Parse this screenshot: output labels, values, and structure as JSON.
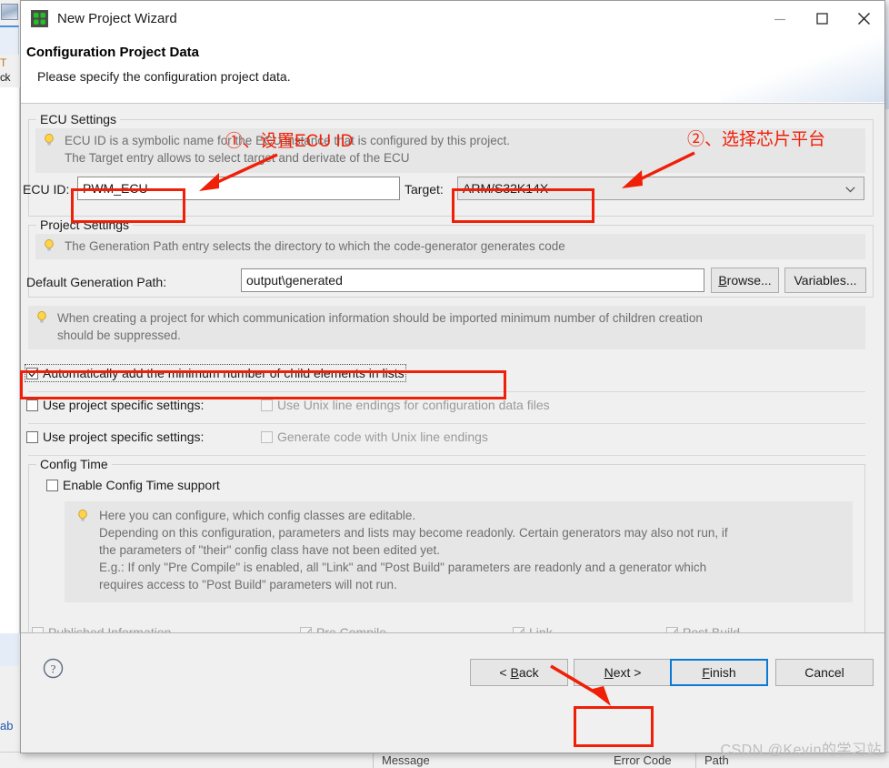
{
  "window": {
    "title": "New Project Wizard",
    "icon": "puzzle-squares-icon",
    "minimize_label": "Minimize",
    "maximize_label": "Maximize",
    "close_label": "Close"
  },
  "wizard": {
    "heading": "Configuration Project Data",
    "subheading": "Please specify the configuration project data."
  },
  "ecu_settings": {
    "group_label": "ECU Settings",
    "hint_line1": "ECU ID is a symbolic name for the ECU instance that is configured by this project.",
    "hint_line2": "The Target entry allows to select target and derivate of the ECU",
    "ecu_id_label": "ECU ID:",
    "ecu_id_value": "PWM_ECU",
    "target_label": "Target:",
    "target_value": "ARM/S32K14X"
  },
  "project_settings": {
    "group_label": "Project Settings",
    "hint": "The Generation Path entry selects the directory to which the code-generator generates code",
    "path_label": "Default Generation Path:",
    "path_value": "output\\generated",
    "browse_label": "Browse...",
    "variables_label": "Variables..."
  },
  "minimum_children": {
    "hint_line1": "When creating a project for which communication information should be imported minimum number of children creation",
    "hint_line2": "should be suppressed.",
    "auto_add_label": "Automatically add the minimum number of child elements in lists",
    "auto_add_checked": true
  },
  "line_endings": {
    "row1_project_specific_label": "Use project specific settings:",
    "row1_project_specific_checked": false,
    "row1_option_label": "Use Unix line endings for configuration data files",
    "row1_option_checked": false,
    "row2_project_specific_label": "Use project specific settings:",
    "row2_project_specific_checked": false,
    "row2_option_label": "Generate code with Unix line endings",
    "row2_option_checked": false
  },
  "config_time": {
    "group_label": "Config Time",
    "enable_label": "Enable Config Time support",
    "enable_checked": false,
    "hint_line1": "Here you can configure, which config classes are editable.",
    "hint_line2": "Depending on this configuration, parameters and lists may become readonly. Certain generators may also not run, if",
    "hint_line3": "the parameters of \"their\" config class have not been edited yet.",
    "hint_line4": "E.g.: If only \"Pre Compile\" is enabled, all \"Link\" and \"Post Build\" parameters are readonly and a generator which",
    "hint_line5": "requires access to \"Post Build\" parameters will not run.",
    "classes": [
      {
        "label": "Published Information",
        "mnemonic": "h",
        "checked": false,
        "enabled": false
      },
      {
        "label": "Pre Compile",
        "mnemonic": "P",
        "checked": true,
        "enabled": false
      },
      {
        "label": "Link",
        "mnemonic": "k",
        "checked": true,
        "enabled": false
      },
      {
        "label": "Post Build",
        "mnemonic": "B",
        "checked": true,
        "enabled": false
      }
    ]
  },
  "buttons": {
    "help": "?",
    "back": "< Back",
    "next": "Next >",
    "finish": "Finish",
    "cancel": "Cancel"
  },
  "annotations": {
    "step1": "①、设置ECU ID",
    "step2": "②、选择芯片平台"
  },
  "background": {
    "problems_message_col": "Message",
    "problems_errorcode_col": "Error Code",
    "problems_path_col": "Path",
    "tab_label_1": "T",
    "tab_label_2": "ck",
    "link_text": "ab"
  },
  "watermark": "CSDN @Kevin的学习站",
  "colors": {
    "accent_blue": "#0a7ad6",
    "annotation_red": "#f01f07",
    "hint_bg": "#e6e6e6",
    "dialog_bg": "#f0f0f0",
    "icon_green": "#22c022"
  }
}
